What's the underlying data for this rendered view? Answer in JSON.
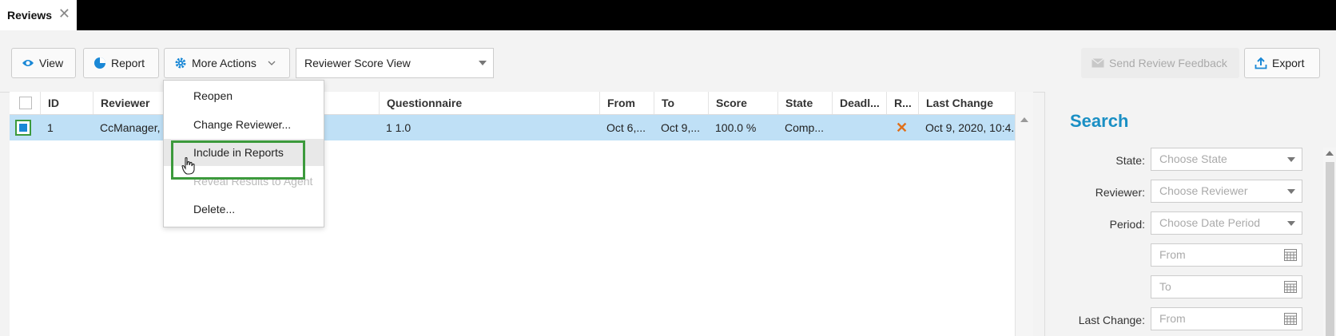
{
  "tab": {
    "title": "Reviews",
    "close_glyph": "✕"
  },
  "toolbar": {
    "view_label": "View",
    "report_label": "Report",
    "more_actions_label": "More Actions",
    "view_select_value": "Reviewer Score View",
    "send_feedback_label": "Send Review Feedback",
    "export_label": "Export"
  },
  "grid": {
    "columns": [
      "ID",
      "Reviewer",
      "Questionnaire",
      "From",
      "To",
      "Score",
      "State",
      "Deadl...",
      "R...",
      "Last Change"
    ],
    "rows": [
      {
        "selected": true,
        "id": "1",
        "reviewer": "CcManager,",
        "questionnaire": "1 1.0",
        "from": "Oct 6,...",
        "to": "Oct 9,...",
        "score": "100.0 %",
        "state": "Comp...",
        "deadline": "",
        "r_icon": "close-x-icon",
        "r_glyph": "✕",
        "last_change": "Oct 9, 2020, 10:4..."
      }
    ]
  },
  "menu": {
    "items": [
      {
        "label": "Reopen",
        "state": "normal"
      },
      {
        "label": "Change Reviewer...",
        "state": "normal"
      },
      {
        "label": "Include in Reports",
        "state": "hover"
      },
      {
        "label": "Reveal Results to Agent",
        "state": "disabled"
      },
      {
        "label": "Delete...",
        "state": "normal"
      }
    ]
  },
  "search": {
    "title": "Search",
    "state_label": "State:",
    "state_placeholder": "Choose State",
    "reviewer_label": "Reviewer:",
    "reviewer_placeholder": "Choose Reviewer",
    "period_label": "Period:",
    "period_placeholder": "Choose Date Period",
    "from_placeholder": "From",
    "to_placeholder": "To",
    "last_change_label": "Last Change:",
    "last_change_from_placeholder": "From"
  },
  "colors": {
    "accent": "#1a8fc4",
    "selected_row": "#bfe0f6",
    "highlight_box": "#3c9a3c",
    "x_mark": "#e0701a"
  }
}
